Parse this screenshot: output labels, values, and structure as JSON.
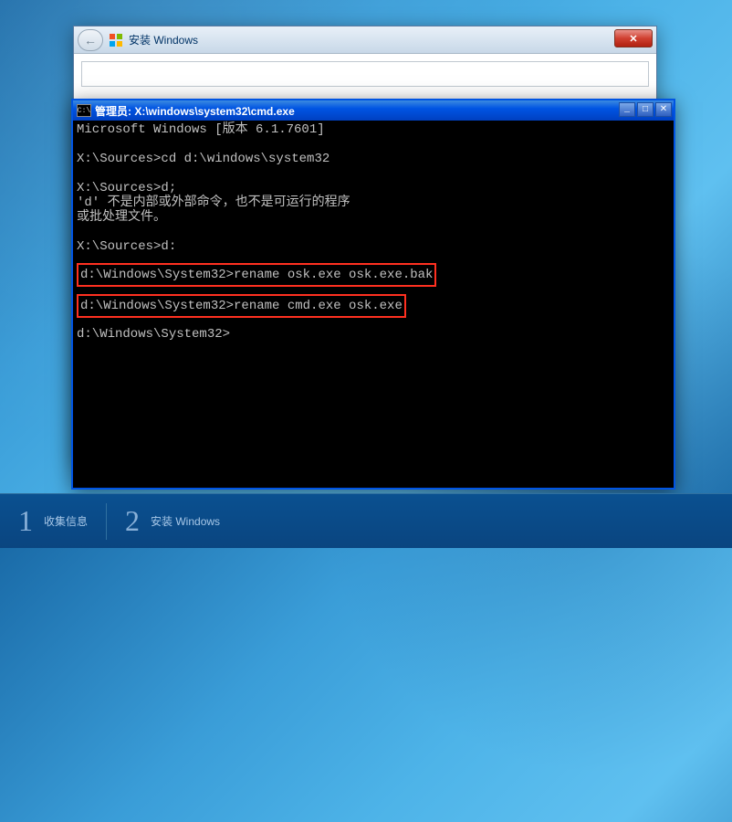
{
  "installer": {
    "title": "安装 Windows",
    "back_label": "←",
    "close_label": "✕"
  },
  "cmd": {
    "icon_text": "C:\\",
    "title": "管理员: X:\\windows\\system32\\cmd.exe",
    "min_label": "_",
    "max_label": "□",
    "close_label": "✕",
    "lines": {
      "l1": "Microsoft Windows [版本 6.1.7601]",
      "l2": "X:\\Sources>cd d:\\windows\\system32",
      "l3": "X:\\Sources>d;",
      "l4": "'d' 不是内部或外部命令，也不是可运行的程序",
      "l5": "或批处理文件。",
      "l6": "X:\\Sources>d:",
      "h1": "d:\\Windows\\System32>rename osk.exe osk.exe.bak",
      "h2": "d:\\Windows\\System32>rename cmd.exe osk.exe",
      "l7": "d:\\Windows\\System32>"
    }
  },
  "steps": {
    "s1_num": "1",
    "s1_label": "收集信息",
    "s2_num": "2",
    "s2_label": "安装 Windows"
  }
}
